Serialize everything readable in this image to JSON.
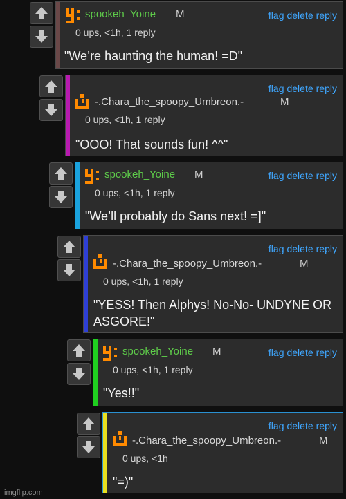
{
  "actions": {
    "flag": "flag",
    "delete": "delete",
    "reply": "reply"
  },
  "comments": [
    {
      "user": "spookeh_Yoine",
      "mod": "M",
      "meta": "0 ups, <1h, 1 reply",
      "text": "\"We’re haunting the human! =D\"",
      "bar_color": "#6a4848",
      "user_color": "#5ecb4a",
      "avatar": "yoine"
    },
    {
      "user": "-.Chara_the_spoopy_Umbreon.-",
      "mod": "M",
      "meta": "0 ups, <1h, 1 reply",
      "text": "\"OOO! That sounds fun! ^^\"",
      "bar_color": "#b81ab0",
      "user_color": "#d8d8d8",
      "avatar": "chara"
    },
    {
      "user": "spookeh_Yoine",
      "mod": "M",
      "meta": "0 ups, <1h, 1 reply",
      "text": "\"We’ll probably do Sans next! =]\"",
      "bar_color": "#1aa2dd",
      "user_color": "#5ecb4a",
      "avatar": "yoine"
    },
    {
      "user": "-.Chara_the_spoopy_Umbreon.-",
      "mod": "M",
      "meta": "0 ups, <1h, 1 reply",
      "text": "\"YESS! Then Alphys! No-No- UNDYNE OR ASGORE!\"",
      "bar_color": "#2e3fd6",
      "user_color": "#d8d8d8",
      "avatar": "chara"
    },
    {
      "user": "spookeh_Yoine",
      "mod": "M",
      "meta": "0 ups, <1h, 1 reply",
      "text": "\"Yes!!\"",
      "bar_color": "#20d020",
      "user_color": "#5ecb4a",
      "avatar": "yoine"
    },
    {
      "user": "-.Chara_the_spoopy_Umbreon.-",
      "mod": "M",
      "meta": "0 ups, <1h",
      "text": "\"=)\"",
      "bar_color": "#e8e020",
      "user_color": "#d8d8d8",
      "avatar": "chara"
    }
  ],
  "watermark": "imgflip.com",
  "colors": {
    "link": "#3fa7ff",
    "avatar": "#ff8a00",
    "panel": "#2c2c2c"
  }
}
